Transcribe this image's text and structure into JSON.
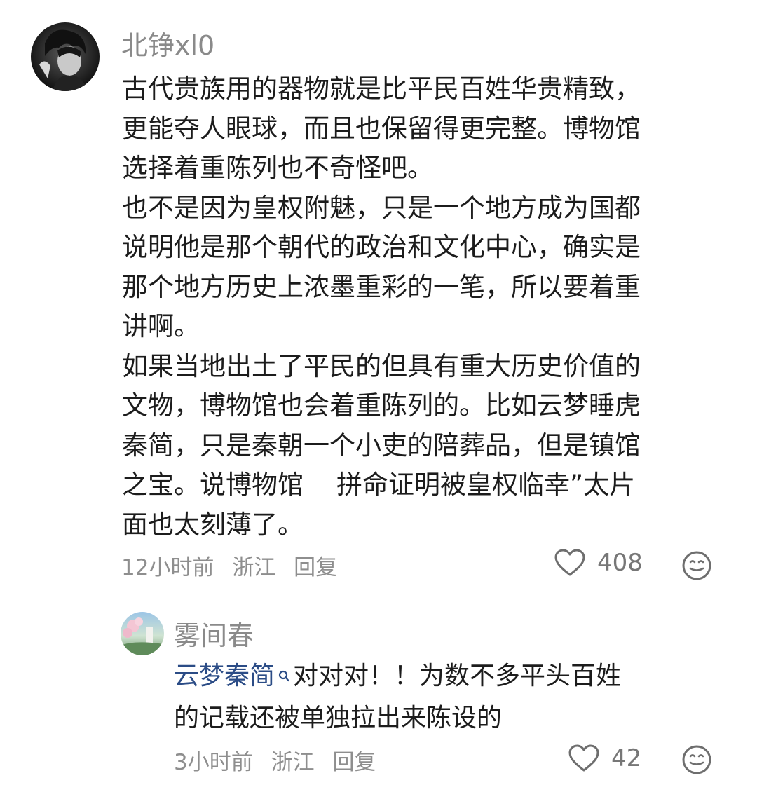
{
  "comments": [
    {
      "username": "北铮xl0",
      "lines": [
        "古代贵族用的器物就是比平民百姓华贵精致，",
        "更能夺人眼球，而且也保留得更完整。博物馆",
        "选择着重陈列也不奇怪吧。",
        "也不是因为皇权附魅，只是一个地方成为国都",
        "说明他是那个朝代的政治和文化中心，确实是",
        "那个地方历史上浓墨重彩的一笔，所以要着重",
        "讲啊。",
        "如果当地出土了平民的但具有重大历史价值的",
        "文物，博物馆也会着重陈列的。比如云梦睡虎",
        "秦简，只是秦朝一个小吏的陪葬品，但是镇馆",
        "之宝。说博物馆    拼命证明被皇权临幸”太片",
        "面也太刻薄了。"
      ],
      "time": "12小时前",
      "location": "浙江",
      "reply_label": "回复",
      "likes": "408",
      "icons": {
        "like": "heart-icon",
        "reaction": "emoji-face-icon"
      }
    },
    {
      "username": "雾间春",
      "topic_link": "云梦秦简",
      "text_line1": "对对对！！为数不多平头百姓",
      "text_line2": "的记载还被单独拉出来陈设的",
      "time": "3小时前",
      "location": "浙江",
      "reply_label": "回复",
      "likes": "42",
      "icons": {
        "like": "heart-icon",
        "reaction": "emoji-face-icon",
        "link": "search-icon"
      }
    }
  ],
  "colors": {
    "link": "#2b4c86",
    "meta": "#8e8e8e",
    "text": "#1c1c1c"
  }
}
